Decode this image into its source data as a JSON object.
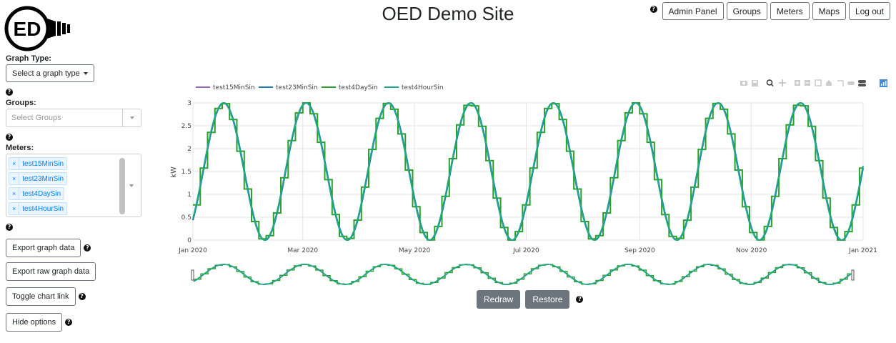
{
  "header": {
    "title": "OED Demo Site",
    "logo_text": "ED",
    "nav": [
      "Admin Panel",
      "Groups",
      "Meters",
      "Maps",
      "Log out"
    ]
  },
  "sidebar": {
    "graph_type_label": "Graph Type:",
    "graph_type_button": "Select a graph type",
    "groups_label": "Groups:",
    "groups_placeholder": "Select Groups",
    "meters_label": "Meters:",
    "meters_selected": [
      "test15MinSin",
      "test23MinSin",
      "test4DaySin",
      "test4HourSin"
    ],
    "export_graph": "Export graph data",
    "export_raw": "Export raw graph data",
    "toggle_link": "Toggle chart link",
    "hide_options": "Hide options"
  },
  "controls": {
    "redraw": "Redraw",
    "restore": "Restore"
  },
  "colors": {
    "accent": "#007eff",
    "button_gray": "#6c757d"
  },
  "chart_data": {
    "type": "line",
    "ylabel": "kW",
    "ylim": [
      0,
      3
    ],
    "y_ticks": [
      "0",
      "0.5",
      "1",
      "1.5",
      "2",
      "2.5",
      "3"
    ],
    "x_ticks": [
      "Jan 2020",
      "Mar 2020",
      "May 2020",
      "Jul 2020",
      "Sep 2020",
      "Nov 2020",
      "Jan 2021"
    ],
    "x_range": [
      "2020-01-01",
      "2021-01-01"
    ],
    "period_days": 45,
    "series": [
      {
        "name": "test15MinSin",
        "color": "#9467bd",
        "style": "smooth"
      },
      {
        "name": "test23MinSin",
        "color": "#1f77b4",
        "style": "smooth"
      },
      {
        "name": "test4DaySin",
        "color": "#2ca02c",
        "style": "step4day"
      },
      {
        "name": "test4HourSin",
        "color": "#1fa98a",
        "style": "smooth"
      }
    ],
    "legend_position": "top-left"
  }
}
